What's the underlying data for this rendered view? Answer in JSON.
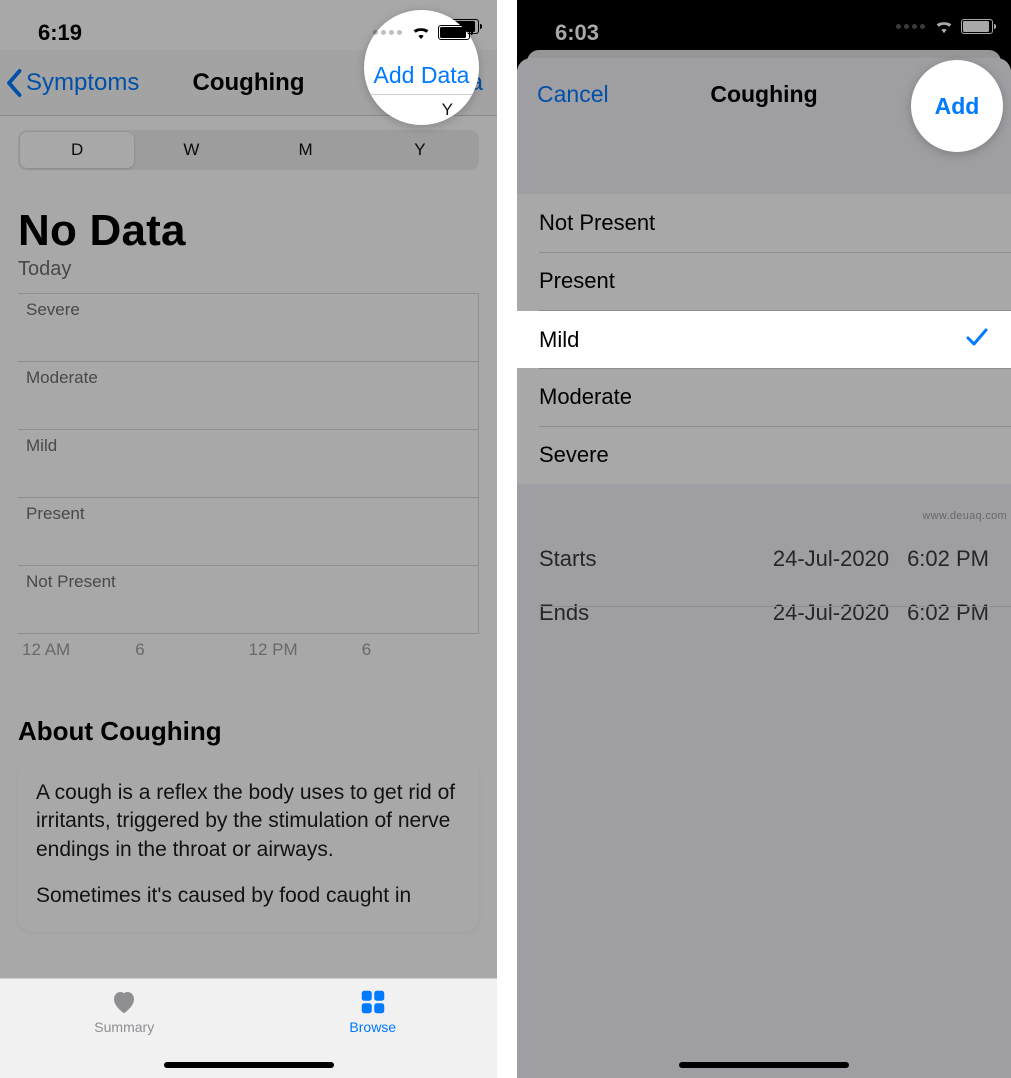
{
  "left": {
    "status": {
      "time": "6:19"
    },
    "nav": {
      "back_label": "Symptoms",
      "title": "Coughing",
      "add_label": "Add Data"
    },
    "segments": {
      "d": "D",
      "w": "W",
      "m": "M",
      "y": "Y"
    },
    "no_data_title": "No Data",
    "today_label": "Today",
    "chart_rows": {
      "severe": "Severe",
      "moderate": "Moderate",
      "mild": "Mild",
      "present": "Present",
      "not_present": "Not Present"
    },
    "axis": {
      "a": "12 AM",
      "b": "6",
      "c": "12 PM",
      "d": "6"
    },
    "about": {
      "title": "About Coughing",
      "p1": "A cough is a reflex the body uses to get rid of irritants, triggered by the stimulation of nerve endings in the throat or airways.",
      "p2": "Sometimes it's caused by food caught in"
    },
    "tabs": {
      "summary": "Summary",
      "browse": "Browse"
    }
  },
  "right": {
    "status": {
      "time": "6:03"
    },
    "sheet": {
      "cancel": "Cancel",
      "title": "Coughing",
      "add": "Add"
    },
    "options": {
      "not_present": "Not Present",
      "present": "Present",
      "mild": "Mild",
      "moderate": "Moderate",
      "severe": "Severe"
    },
    "times": {
      "starts_label": "Starts",
      "starts_date": "24-Jul-2020",
      "starts_time": "6:02 PM",
      "ends_label": "Ends",
      "ends_date": "24-Jul-2020",
      "ends_time": "6:02 PM"
    }
  },
  "watermark": "www.deuaq.com",
  "colors": {
    "accent": "#007aff"
  }
}
